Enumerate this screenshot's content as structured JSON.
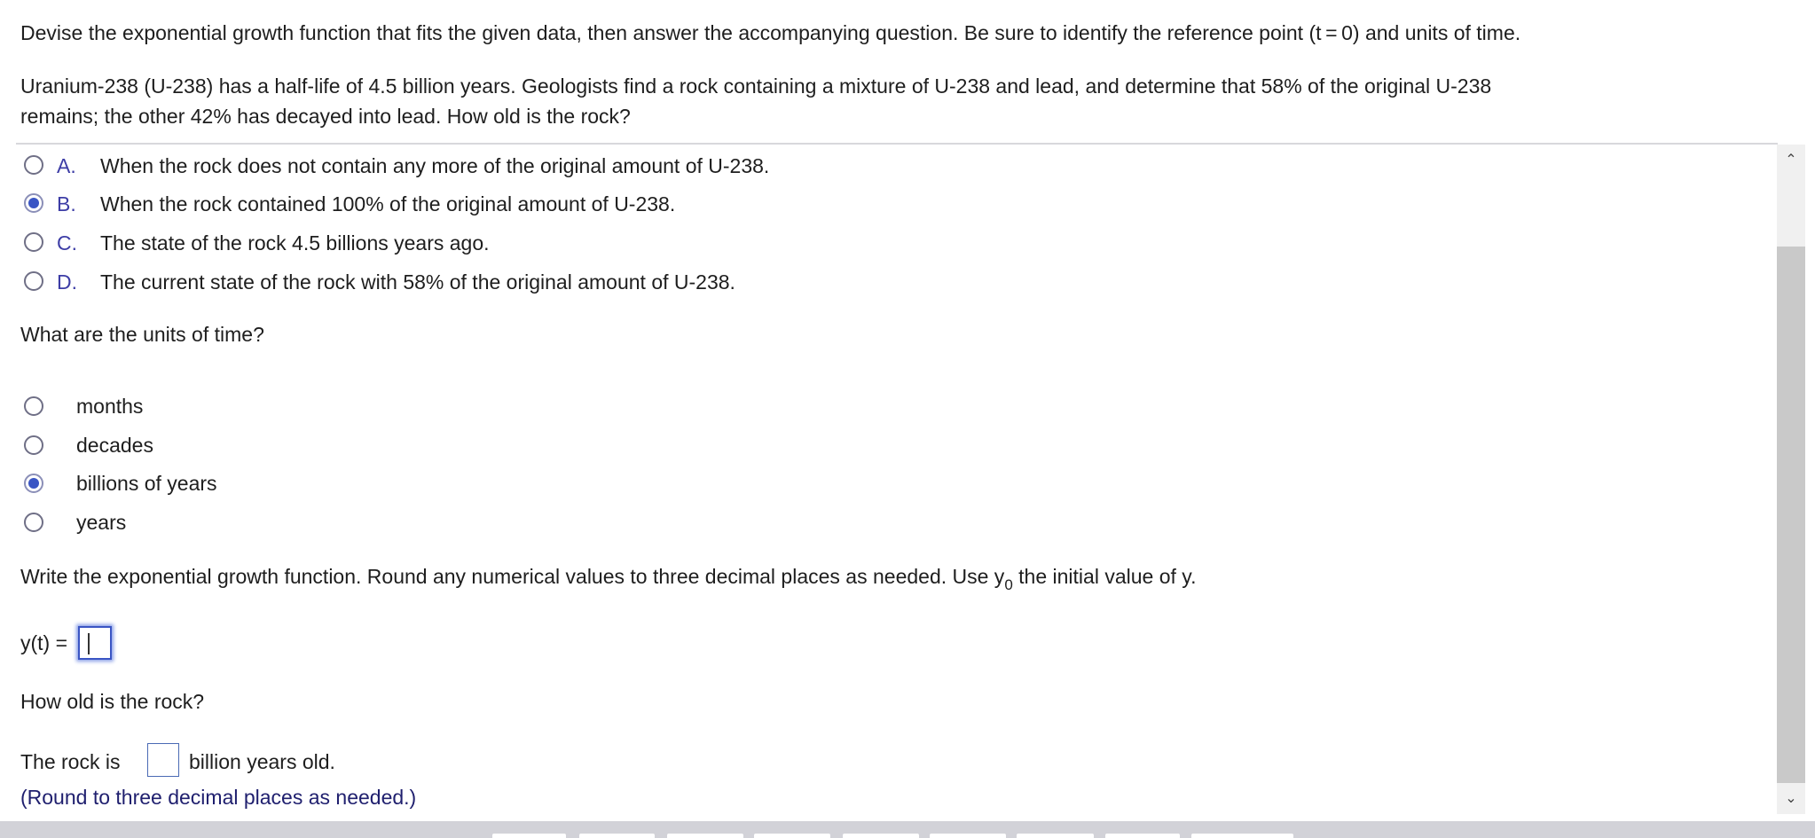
{
  "instructions": "Devise the exponential growth function that fits the given data, then answer the accompanying question. Be sure to identify the reference point (t = 0) and units of time.",
  "problem": {
    "line1": "Uranium-238 (U-238) has a half-life of 4.5 billion years. Geologists find a rock containing a mixture of U-238 and lead, and determine that 58% of the original U-238",
    "line2": "remains; the other 42% has decayed into lead. How old is the rock?"
  },
  "reference_point": {
    "selected": "B",
    "choices": [
      {
        "letter": "A.",
        "text": "When the rock does not contain any more of the original amount of U-238.",
        "checked": false
      },
      {
        "letter": "B.",
        "text": "When the rock contained 100% of the original amount of U-238.",
        "checked": true
      },
      {
        "letter": "C.",
        "text": "The state of the rock 4.5 billions years ago.",
        "checked": false
      },
      {
        "letter": "D.",
        "text": "The current state of the rock with 58% of the original amount of U-238.",
        "checked": false
      }
    ]
  },
  "units": {
    "question": "What are the units of time?",
    "selected": "billions of years",
    "options": [
      {
        "label": "months",
        "checked": false
      },
      {
        "label": "decades",
        "checked": false
      },
      {
        "label": "billions of years",
        "checked": true
      },
      {
        "label": "years",
        "checked": false
      }
    ]
  },
  "function_question": {
    "text_before": "Write the exponential growth function. Round any numerical values to three decimal places as needed. Use y",
    "subscript": "0",
    "text_after": " the initial value of y.",
    "label": "y(t) =",
    "value": ""
  },
  "age_question": {
    "question": "How old is the rock?",
    "prefix": "The rock is",
    "value": "",
    "suffix": "billion years old.",
    "hint": "(Round to three decimal places as needed.)"
  },
  "scrollbar": {
    "up_icon": "⌃",
    "down_icon": "⌄"
  }
}
